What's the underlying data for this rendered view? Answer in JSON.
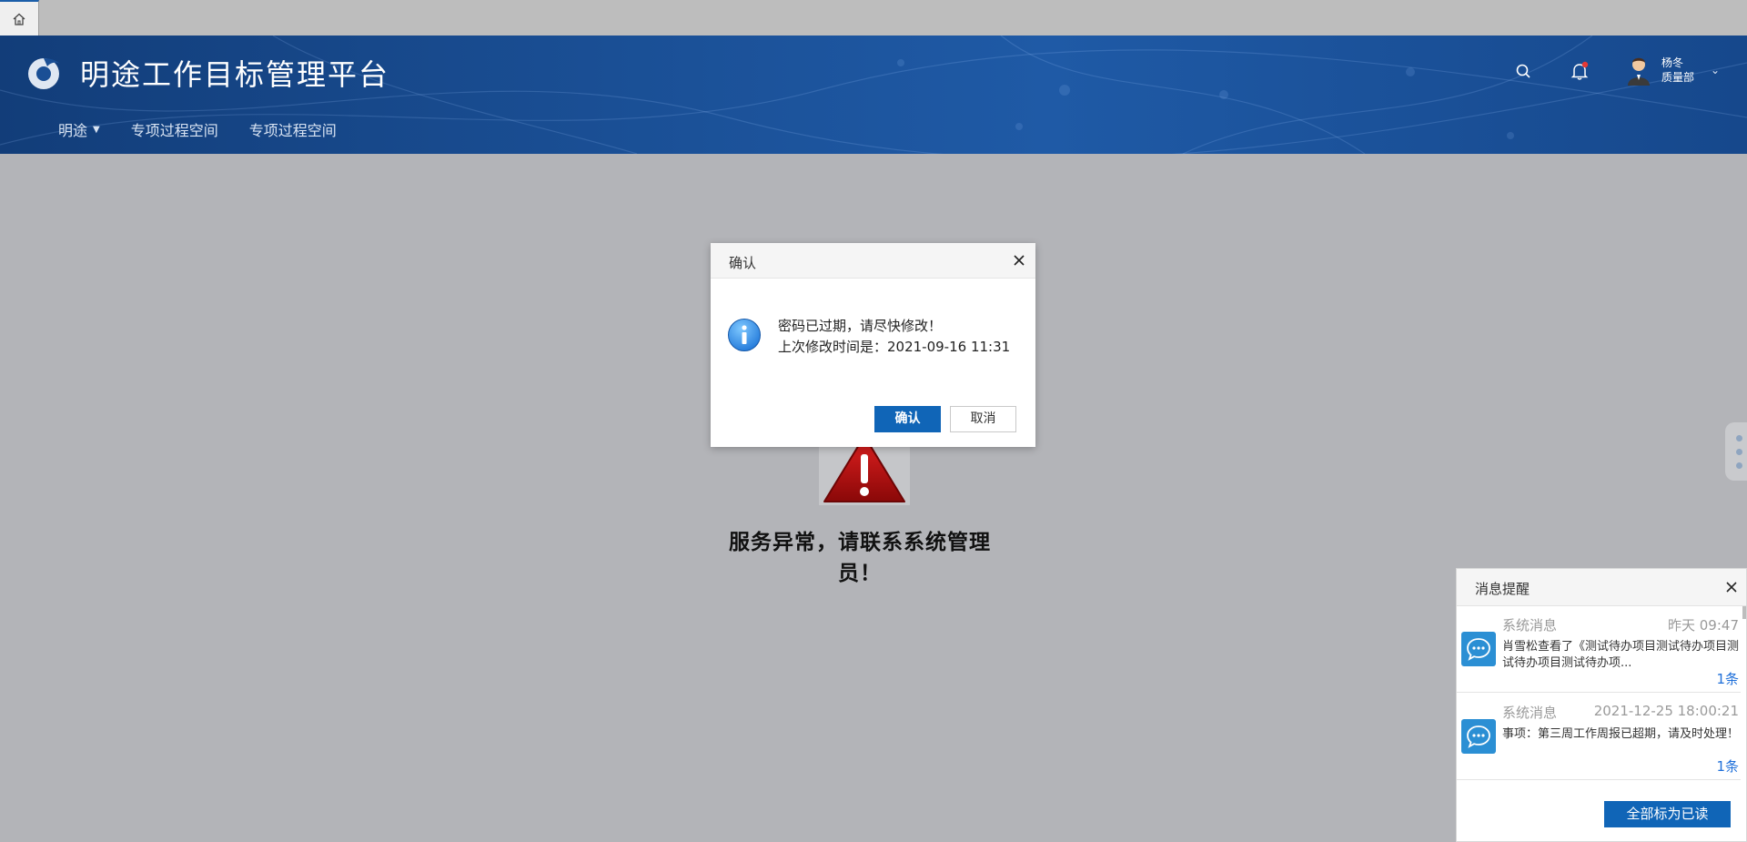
{
  "app": {
    "title": "明途工作目标管理平台",
    "icons": [
      "home-icon",
      "logo-icon",
      "search-icon",
      "bell-icon",
      "chevron-down-icon"
    ]
  },
  "nav": {
    "items": [
      {
        "label": "明途",
        "has_dropdown": true
      },
      {
        "label": "专项过程空间"
      },
      {
        "label": "专项过程空间"
      }
    ]
  },
  "user": {
    "name": "杨冬",
    "dept": "质量部"
  },
  "colors": {
    "header": "#1a4f95",
    "primary_button": "#1065b7",
    "page_bg": "#b3b4b8",
    "notification_dot": "#e53935",
    "link": "#1e6fd9"
  },
  "error": {
    "message": "服务异常，请联系系统管理员！"
  },
  "dialog": {
    "title": "确认",
    "line1": "密码已过期，请尽快修改！",
    "line2": "上次修改时间是：2021-09-16 11:31",
    "confirm_label": "确认",
    "cancel_label": "取消"
  },
  "messages": {
    "title": "消息提醒",
    "items": [
      {
        "type": "系统消息",
        "time": "昨天 09:47",
        "body": "肖雪松查看了《测试待办项目测试待办项目测试待办项目测试待办项...",
        "count": "1条"
      },
      {
        "type": "系统消息",
        "time": "2021-12-25 18:00:21",
        "body": "事项：第三周工作周报已超期，请及时处理！",
        "count": "1条"
      }
    ],
    "mark_all_label": "全部标为已读"
  }
}
